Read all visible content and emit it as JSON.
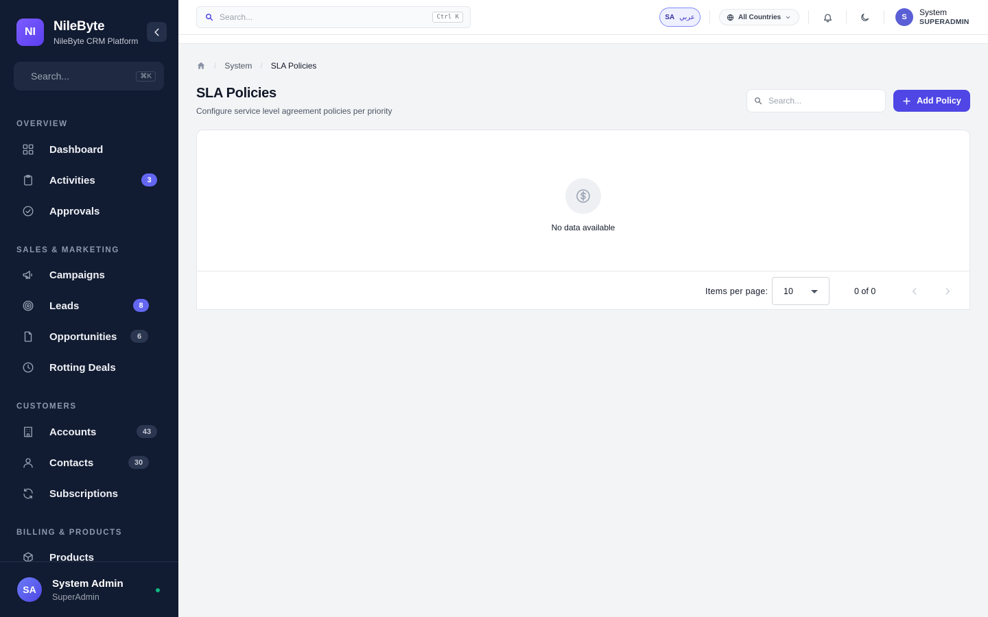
{
  "sidebar": {
    "brand": {
      "logo": "NI",
      "name": "NileByte",
      "subtitle": "NileByte CRM Platform"
    },
    "search": {
      "placeholder": "Search...",
      "shortcut": "⌘K"
    },
    "sections": [
      {
        "label": "OVERVIEW"
      },
      {
        "label": "SALES & MARKETING"
      },
      {
        "label": "CUSTOMERS"
      },
      {
        "label": "BILLING & PRODUCTS"
      }
    ],
    "items": [
      {
        "label": "Dashboard",
        "icon": "grid-icon"
      },
      {
        "label": "Activities",
        "icon": "clipboard-icon",
        "badge": "3"
      },
      {
        "label": "Approvals",
        "icon": "check-circle-icon"
      },
      {
        "label": "Campaigns",
        "icon": "megaphone-icon"
      },
      {
        "label": "Leads",
        "icon": "target-icon",
        "badge": "8"
      },
      {
        "label": "Opportunities",
        "icon": "document-icon",
        "badge": "6"
      },
      {
        "label": "Rotting Deals",
        "icon": "clock-icon"
      },
      {
        "label": "Accounts",
        "icon": "building-icon",
        "badge": "43"
      },
      {
        "label": "Contacts",
        "icon": "user-icon",
        "badge": "30"
      },
      {
        "label": "Subscriptions",
        "icon": "refresh-icon"
      },
      {
        "label": "Products",
        "icon": "box-icon"
      }
    ],
    "footer": {
      "initials": "SA",
      "name": "System Admin",
      "role": "SuperAdmin",
      "status": "online"
    }
  },
  "topbar": {
    "search": {
      "placeholder": "Search...",
      "shortcut": "Ctrl K"
    },
    "language": {
      "code": "SA",
      "label": "عربي"
    },
    "country": {
      "label": "All Countries"
    },
    "user": {
      "initial": "S",
      "name": "System",
      "role": "SUPERADMIN"
    }
  },
  "page": {
    "breadcrumb": [
      "System",
      "SLA Policies"
    ],
    "title": "SLA Policies",
    "subtitle": "Configure service level agreement policies per priority",
    "search_placeholder": "Search...",
    "add_button": "Add Policy"
  },
  "table": {
    "empty_message": "No data available",
    "items_per_page_label": "Items per page:",
    "items_per_page": "10",
    "range": "0 of 0"
  },
  "colors": {
    "sidebar_bg": "#111b31",
    "accent": "#4f46e5",
    "badge_accent": "#6366f1",
    "online": "#10b981"
  }
}
